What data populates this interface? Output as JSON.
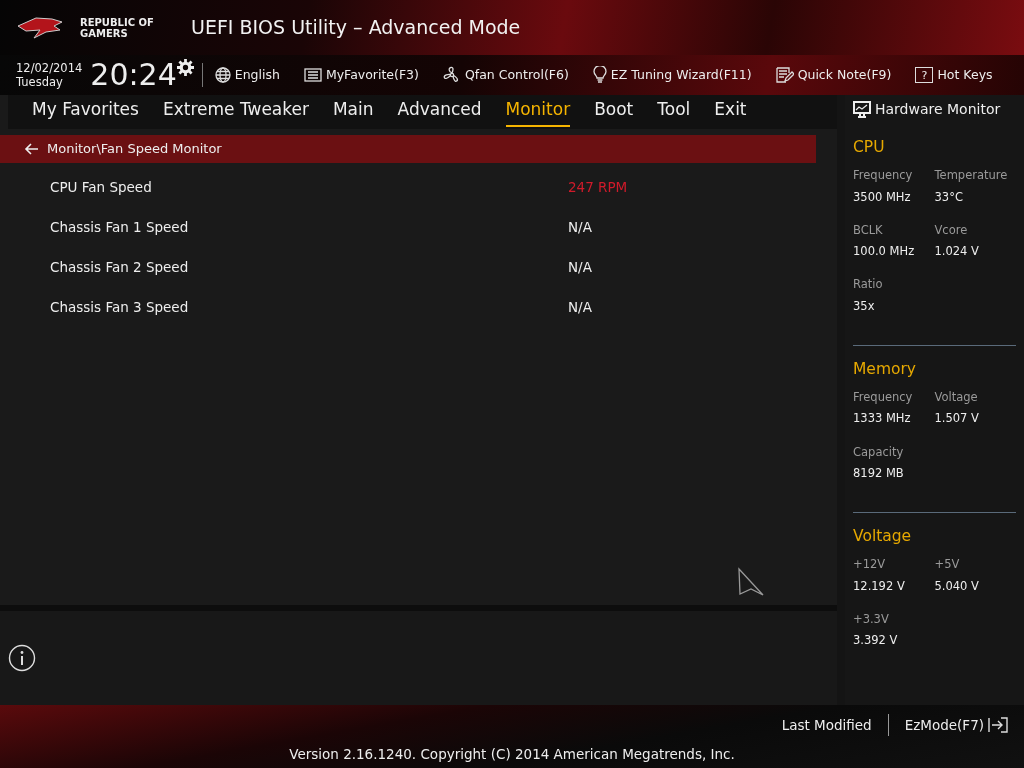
{
  "header": {
    "logo_text": "REPUBLIC OF GAMERS",
    "title": "UEFI BIOS Utility – Advanced Mode"
  },
  "toolbar": {
    "date": "12/02/2014",
    "day": "Tuesday",
    "time": "20:24",
    "items": [
      {
        "label": "English",
        "kind": "globe"
      },
      {
        "label": "MyFavorite(F3)",
        "kind": "favorite"
      },
      {
        "label": "Qfan Control(F6)",
        "kind": "fan"
      },
      {
        "label": "EZ Tuning Wizard(F11)",
        "kind": "bulb"
      },
      {
        "label": "Quick Note(F9)",
        "kind": "note"
      },
      {
        "label": "Hot Keys",
        "kind": "help",
        "glyph": "?"
      }
    ]
  },
  "tabs": [
    {
      "label": "My Favorites",
      "selected": false
    },
    {
      "label": "Extreme Tweaker",
      "selected": false
    },
    {
      "label": "Main",
      "selected": false
    },
    {
      "label": "Advanced",
      "selected": false
    },
    {
      "label": "Monitor",
      "selected": true
    },
    {
      "label": "Boot",
      "selected": false
    },
    {
      "label": "Tool",
      "selected": false
    },
    {
      "label": "Exit",
      "selected": false
    }
  ],
  "breadcrumb": "Monitor\\Fan Speed Monitor",
  "rows": [
    {
      "label": "CPU Fan Speed",
      "value": "247 RPM",
      "highlighted": true
    },
    {
      "label": "Chassis Fan 1 Speed",
      "value": "N/A",
      "highlighted": false
    },
    {
      "label": "Chassis Fan 2 Speed",
      "value": "N/A",
      "highlighted": false
    },
    {
      "label": "Chassis Fan 3 Speed",
      "value": "N/A",
      "highlighted": false
    }
  ],
  "hardware_monitor": {
    "title": "Hardware Monitor",
    "sections": [
      {
        "title": "CPU",
        "items": [
          {
            "label": "Frequency",
            "value": "3500 MHz"
          },
          {
            "label": "Temperature",
            "value": "33°C"
          },
          {
            "label": "BCLK",
            "value": "100.0 MHz"
          },
          {
            "label": "Vcore",
            "value": "1.024 V"
          },
          {
            "label": "Ratio",
            "value": "35x"
          }
        ]
      },
      {
        "title": "Memory",
        "items": [
          {
            "label": "Frequency",
            "value": "1333 MHz"
          },
          {
            "label": "Voltage",
            "value": "1.507 V"
          },
          {
            "label": "Capacity",
            "value": "8192 MB"
          }
        ]
      },
      {
        "title": "Voltage",
        "items": [
          {
            "label": "+12V",
            "value": "12.192 V"
          },
          {
            "label": "+5V",
            "value": "5.040 V"
          },
          {
            "label": "+3.3V",
            "value": "3.392 V"
          }
        ]
      }
    ]
  },
  "footer": {
    "last_modified": "Last Modified",
    "ez_mode": "EzMode(F7)",
    "copyright": "Version 2.16.1240. Copyright (C) 2014 American Megatrends, Inc."
  }
}
